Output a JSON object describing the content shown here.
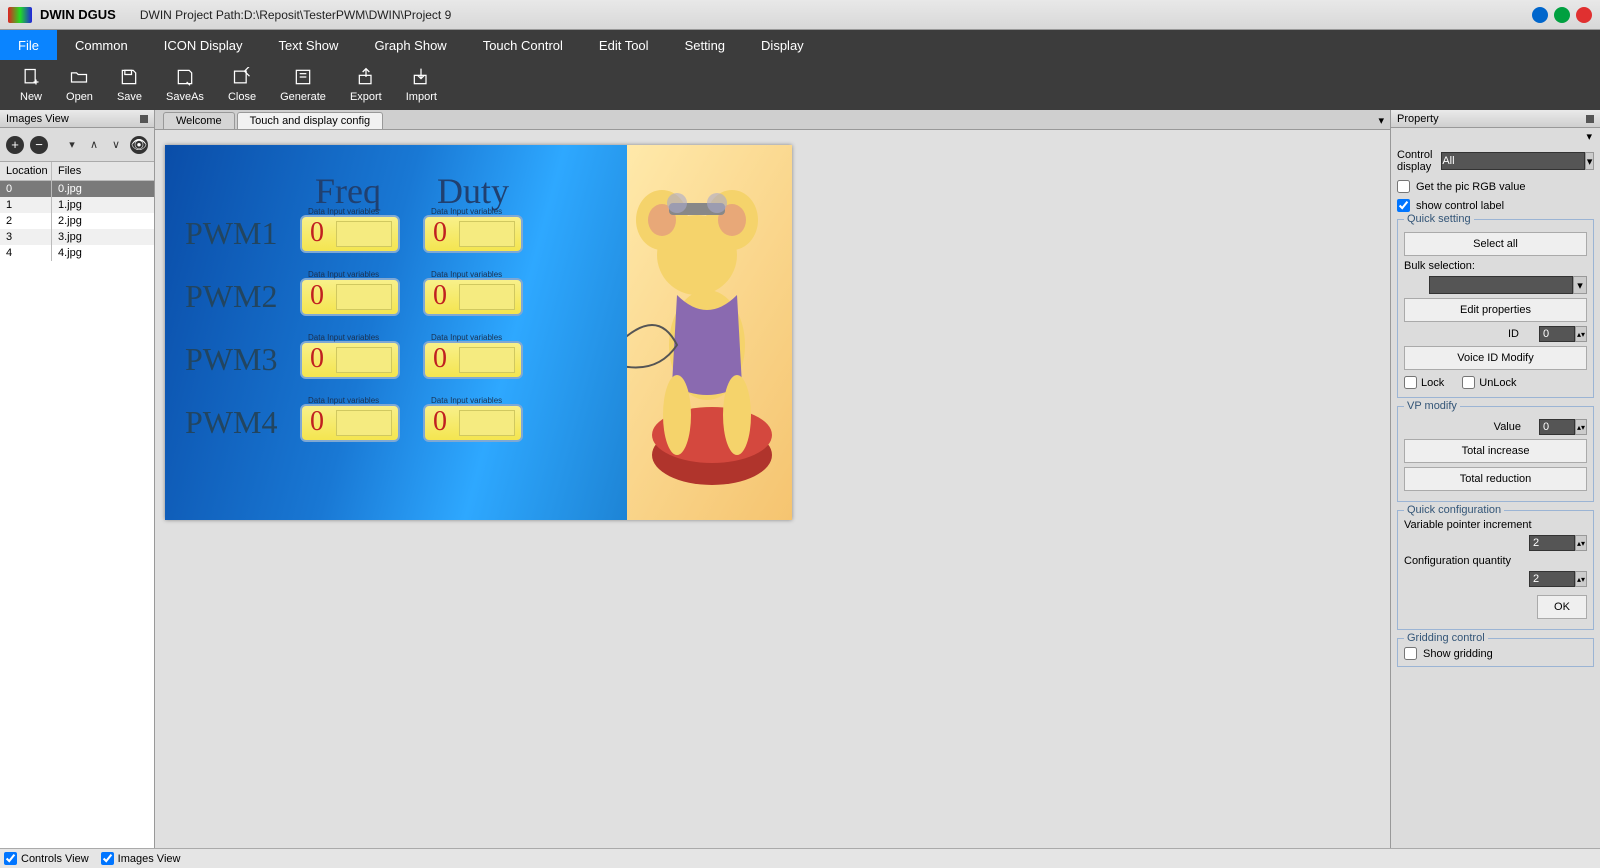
{
  "title_bar": {
    "app_name": "DWIN DGUS",
    "path": "DWIN Project Path:D:\\Reposit\\TesterPWM\\DWIN\\Project 9"
  },
  "menu": {
    "items": [
      "File",
      "Common",
      "ICON Display",
      "Text Show",
      "Graph Show",
      "Touch Control",
      "Edit Tool",
      "Setting",
      "Display"
    ],
    "active_index": 0
  },
  "toolbar": {
    "items": [
      "New",
      "Open",
      "Save",
      "SaveAs",
      "Close",
      "Generate",
      "Export",
      "Import"
    ]
  },
  "left_panel": {
    "title": "Images View",
    "columns": [
      "Location",
      "Files"
    ],
    "rows": [
      {
        "loc": "0",
        "file": "0.jpg",
        "selected": true
      },
      {
        "loc": "1",
        "file": "1.jpg"
      },
      {
        "loc": "2",
        "file": "2.jpg"
      },
      {
        "loc": "3",
        "file": "3.jpg"
      },
      {
        "loc": "4",
        "file": "4.jpg"
      }
    ]
  },
  "tabs": {
    "list": [
      "Welcome",
      "Touch and display config"
    ],
    "active_index": 1
  },
  "stage": {
    "headers": {
      "freq": "Freq",
      "duty": "Duty"
    },
    "rows": [
      "PWM1",
      "PWM2",
      "PWM3",
      "PWM4"
    ],
    "cell_value": "0",
    "overlay_label": "Data Input variables"
  },
  "property": {
    "title": "Property",
    "control_display_label": "Control display",
    "control_display_value": "All",
    "get_pic_rgb": "Get the pic RGB value",
    "show_control_label": "show control label",
    "quick_setting": {
      "legend": "Quick setting",
      "select_all": "Select all",
      "bulk_selection": "Bulk selection:",
      "edit_properties": "Edit properties",
      "id_label": "ID",
      "id_value": "0",
      "voice_id": "Voice ID Modify",
      "lock": "Lock",
      "unlock": "UnLock"
    },
    "vp_modify": {
      "legend": "VP modify",
      "value_label": "Value",
      "value": "0",
      "total_increase": "Total increase",
      "total_reduction": "Total reduction"
    },
    "quick_config": {
      "legend": "Quick configuration",
      "vpi": "Variable pointer increment",
      "vpi_value": "2",
      "cq": "Configuration quantity",
      "cq_value": "2",
      "ok": "OK"
    },
    "gridding": {
      "legend": "Gridding control",
      "show": "Show gridding"
    }
  },
  "status": {
    "controls_view": "Controls View",
    "images_view": "Images View"
  }
}
